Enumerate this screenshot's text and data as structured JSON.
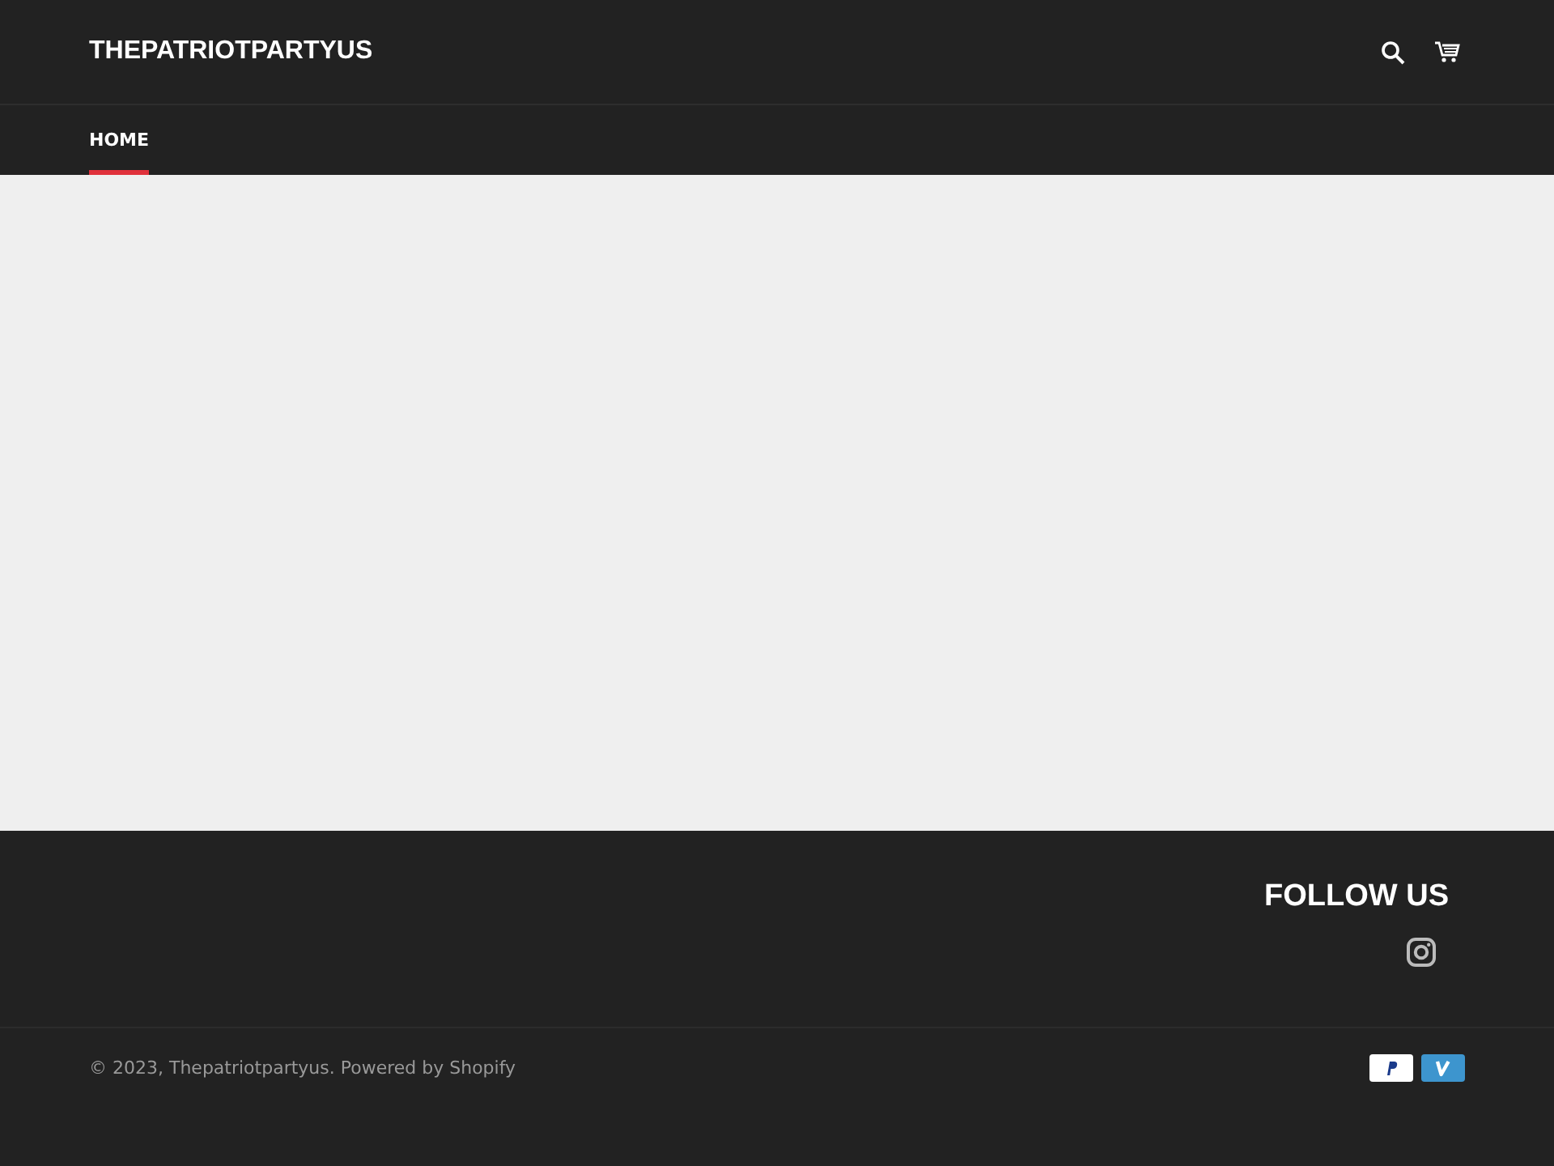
{
  "header": {
    "logo": "THEPATRIOTPARTYUS"
  },
  "nav": {
    "items": [
      {
        "label": "HOME",
        "selected": true
      }
    ]
  },
  "footer": {
    "follow_title": "FOLLOW US",
    "copyright": "© 2023, Thepatriotpartyus. Powered by Shopify"
  }
}
